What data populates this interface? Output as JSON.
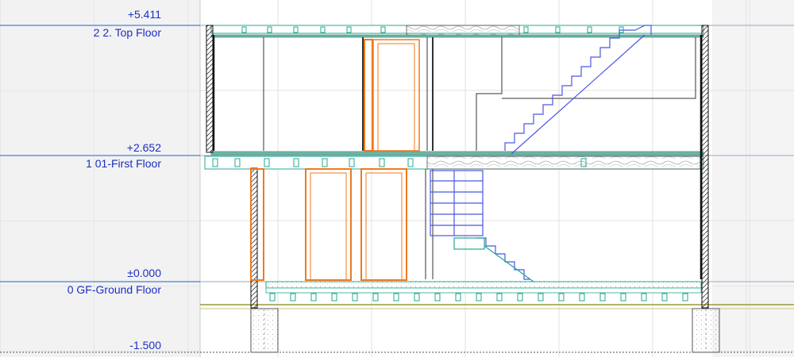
{
  "levels": [
    {
      "elevation": "+5.411",
      "name": "2 2. Top Floor"
    },
    {
      "elevation": "+2.652",
      "name": "1 01-First Floor"
    },
    {
      "elevation": "±0.000",
      "name": "0 GF-Ground Floor"
    },
    {
      "elevation": "-1.500",
      "name": ""
    }
  ],
  "colors": {
    "level_line": "#1a66cc",
    "level_text": "#1b2fc4",
    "door": "#f07a1e",
    "stair": "#4a57e0",
    "teal": "#20a890",
    "grid_bg": "#f2f2f2",
    "grid_line": "#d7d7d7",
    "wall": "#222222"
  }
}
